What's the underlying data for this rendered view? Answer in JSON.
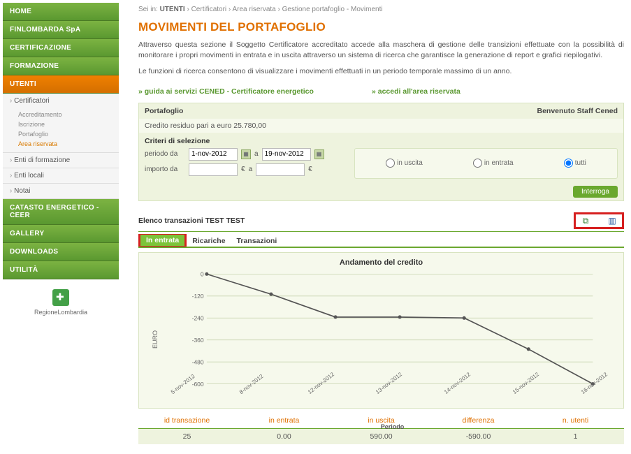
{
  "breadcrumb": {
    "prefix": "Sei in:",
    "b1": "UTENTI",
    "rest": " › Certificatori › Area riservata › Gestione portafoglio - Movimenti"
  },
  "sidebar": {
    "items": [
      "HOME",
      "FINLOMBARDA SpA",
      "CERTIFICAZIONE",
      "FORMAZIONE",
      "UTENTI",
      "CATASTO ENERGETICO - CEER",
      "GALLERY",
      "DOWNLOADS",
      "UTILITÀ"
    ],
    "sub_cert": {
      "parent": "Certificatori",
      "children": [
        "Accreditamento",
        "Iscrizione",
        "Portafoglio",
        "Area riservata"
      ]
    },
    "sub_others": [
      "Enti di formazione",
      "Enti locali",
      "Notai"
    ],
    "logo": "RegioneLombardia"
  },
  "title": "MOVIMENTI DEL PORTAFOGLIO",
  "intro1": "Attraverso questa sezione il Soggetto Certificatore accreditato accede alla maschera di gestione delle transizioni effettuate con la possibilità di monitorare i propri movimenti in entrata e in uscita attraverso un sistema di ricerca che garantisce la generazione di report e grafici riepilogativi.",
  "intro2": "Le funzioni di ricerca consentono di visualizzare i movimenti effettuati in un periodo temporale massimo di un anno.",
  "link1": "guida ai servizi CENED - Certificatore energetico",
  "link2": "accedi all'area riservata",
  "panel": {
    "left": "Portafoglio",
    "right": "Benvenuto Staff Cened",
    "credit": "Credito residuo pari a euro 25.780,00",
    "crit_title": "Criteri di selezione",
    "lbl_periodo": "periodo da",
    "lbl_a": "a",
    "lbl_importo": "importo da",
    "date_from": "1-nov-2012",
    "date_to": "19-nov-2012",
    "euro": "€",
    "radio1": "in uscita",
    "radio2": "in entrata",
    "radio3": "tutti",
    "interroga": "Interroga"
  },
  "elenco": {
    "title": "Elenco transazioni TEST TEST"
  },
  "tabs": [
    "In entrata",
    "Ricariche",
    "Transazioni"
  ],
  "chart_data": {
    "type": "line",
    "title": "Andamento del credito",
    "xlabel": "Periodo",
    "ylabel": "EURO",
    "ylim": [
      -600,
      0
    ],
    "yticks": [
      0,
      -120,
      -240,
      -360,
      -480,
      -600
    ],
    "categories": [
      "5-nov-2012",
      "8-nov-2012",
      "12-nov-2012",
      "13-nov-2012",
      "14-nov-2012",
      "15-nov-2012",
      "16-nov-2012"
    ],
    "values": [
      0,
      -110,
      -235,
      -235,
      -240,
      -410,
      -600
    ]
  },
  "summary": {
    "headers": [
      "id transazione",
      "in entrata",
      "in uscita",
      "differenza",
      "n. utenti"
    ],
    "row": [
      "25",
      "0.00",
      "590.00",
      "-590.00",
      "1"
    ]
  }
}
